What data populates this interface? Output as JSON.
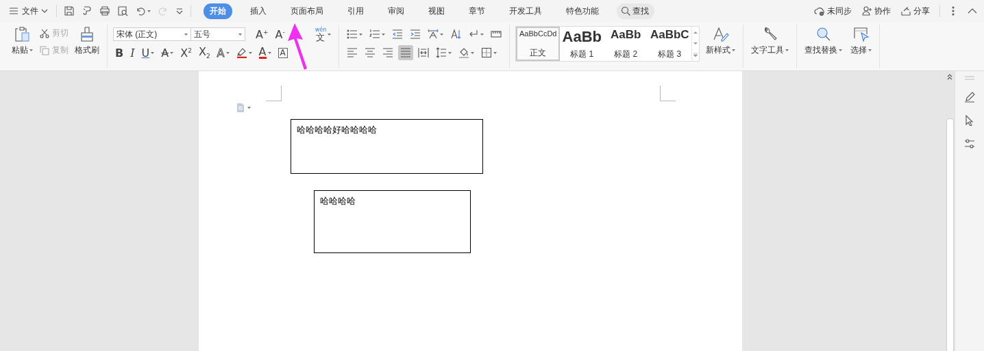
{
  "menu": {
    "label": "文件"
  },
  "tabs": [
    {
      "label": "开始",
      "selected": true
    },
    {
      "label": "插入",
      "selected": false
    },
    {
      "label": "页面布局",
      "selected": false
    },
    {
      "label": "引用",
      "selected": false
    },
    {
      "label": "审阅",
      "selected": false
    },
    {
      "label": "视图",
      "selected": false
    },
    {
      "label": "章节",
      "selected": false
    },
    {
      "label": "开发工具",
      "selected": false
    },
    {
      "label": "特色功能",
      "selected": false
    }
  ],
  "search": {
    "label": "查找"
  },
  "actions": [
    {
      "kind": "sync",
      "label": "未同步"
    },
    {
      "kind": "collab",
      "label": "协作"
    },
    {
      "kind": "share",
      "label": "分享"
    }
  ],
  "clipboard": {
    "paste": "粘贴",
    "cut": {
      "label": "剪切",
      "disabled": true
    },
    "copy": {
      "label": "复制",
      "disabled": true
    },
    "format_painter": "格式刷"
  },
  "font": {
    "name": "宋体 (正文)",
    "size": "五号"
  },
  "font_row1": [
    {
      "kind": "grow",
      "glyph": "A$^{+}$",
      "dropdown": false
    },
    {
      "kind": "shrink",
      "glyph": "A$^{-}$",
      "dropdown": false
    },
    {
      "kind": "phonetic",
      "glyph": "文",
      "ruby": "wén",
      "dropdown": true
    }
  ],
  "font_row2": [
    {
      "kind": "bold",
      "glyph": "B",
      "dropdown": false
    },
    {
      "kind": "italic",
      "glyph": "I",
      "dropdown": false
    },
    {
      "kind": "underline",
      "glyph": "U",
      "dropdown": true
    },
    {
      "kind": "strike",
      "glyph": "A",
      "dropdown": true
    },
    {
      "kind": "sup",
      "glyph": "X$^{2}$",
      "dropdown": false
    },
    {
      "kind": "sub",
      "glyph": "X$_{2}$",
      "dropdown": false
    },
    {
      "kind": "effect",
      "glyph": "A",
      "dropdown": true
    },
    {
      "kind": "highlight",
      "dropdown": true
    },
    {
      "kind": "color",
      "glyph": "A",
      "dropdown": true
    },
    {
      "kind": "border",
      "glyph": "A",
      "dropdown": false
    }
  ],
  "para_row1": [
    {
      "kind": "bullets",
      "dropdown": true
    },
    {
      "kind": "numbering",
      "dropdown": true
    },
    {
      "kind": "outdent",
      "dropdown": false
    },
    {
      "kind": "indent",
      "dropdown": false
    },
    {
      "kind": "layout",
      "dropdown": true
    },
    {
      "kind": "sort",
      "dropdown": false
    },
    {
      "kind": "marks",
      "dropdown": true
    },
    {
      "kind": "ruler",
      "dropdown": false
    }
  ],
  "para_row2": [
    {
      "kind": "left",
      "dropdown": false,
      "selected": false
    },
    {
      "kind": "center",
      "dropdown": false,
      "selected": false
    },
    {
      "kind": "right",
      "dropdown": false,
      "selected": false
    },
    {
      "kind": "justify",
      "dropdown": false,
      "selected": true
    },
    {
      "kind": "distribute",
      "dropdown": false,
      "selected": false
    },
    {
      "kind": "spacing",
      "dropdown": true,
      "selected": false
    },
    {
      "kind": "shading",
      "dropdown": true,
      "selected": false
    },
    {
      "kind": "borders",
      "dropdown": true,
      "selected": false
    }
  ],
  "styles": [
    {
      "kind": "body",
      "preview": "AaBbCcDd",
      "label": "正文",
      "selected": true
    },
    {
      "kind": "h1",
      "preview": "AaBb",
      "label": "标题 1",
      "selected": false
    },
    {
      "kind": "h2",
      "preview": "AaBb",
      "label": "标题 2",
      "selected": false
    },
    {
      "kind": "h3",
      "preview": "AaBbC",
      "label": "标题 3",
      "selected": false
    }
  ],
  "tools": [
    {
      "kind": "new_style",
      "label": "新样式"
    },
    {
      "kind": "text_tools",
      "label": "文字工具"
    },
    {
      "kind": "find_replace",
      "label": "查找替换"
    },
    {
      "kind": "select",
      "label": "选择"
    }
  ],
  "document": {
    "text_boxes": [
      {
        "text": "哈哈哈哈好哈哈哈哈"
      },
      {
        "text": "哈哈哈哈"
      }
    ]
  }
}
